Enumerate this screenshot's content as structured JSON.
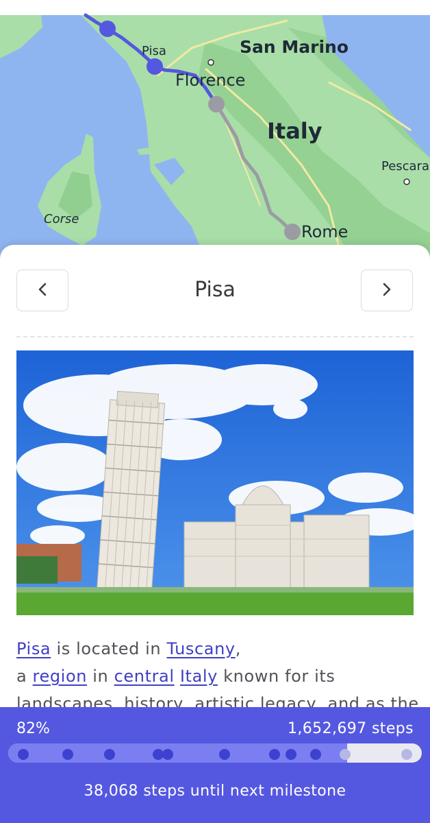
{
  "map": {
    "labels": {
      "pisa": "Pisa",
      "florence": "Florence",
      "san_marino": "San Marino",
      "italy": "Italy",
      "pescara": "Pescara",
      "corse": "Corse",
      "rome": "Rome"
    },
    "colors": {
      "sea": "#8fb5f0",
      "land": "#a9dea8",
      "walked_route": "#5458e0",
      "upcoming_route": "#9b9ca3"
    }
  },
  "location_card": {
    "title": "Pisa",
    "prev_icon": "chevron-left-icon",
    "next_icon": "chevron-right-icon",
    "photo": "Leaning Tower of Pisa and Pisa Cathedral under a blue sky with clouds",
    "description": {
      "link_pisa": "Pisa",
      "text_1": " is located in ",
      "link_tuscany": "Tuscany",
      "text_2": ",",
      "text_3": "a ",
      "link_region": "region",
      "text_4": " in ",
      "link_central": "central",
      "text_5": " ",
      "link_italy": "Italy",
      "text_6": " known for its",
      "text_7": "landscapes, history, artistic legacy, and as the"
    }
  },
  "progress": {
    "percent_label": "82%",
    "fraction": 0.82,
    "steps_label": "1,652,697 steps",
    "milestone_text": "38,068 steps until next milestone",
    "colors": {
      "panel": "#5458e0",
      "fill": "#7a7ef0",
      "dot_reached": "#3d41cf",
      "dot_future": "#b6b8e4"
    }
  }
}
